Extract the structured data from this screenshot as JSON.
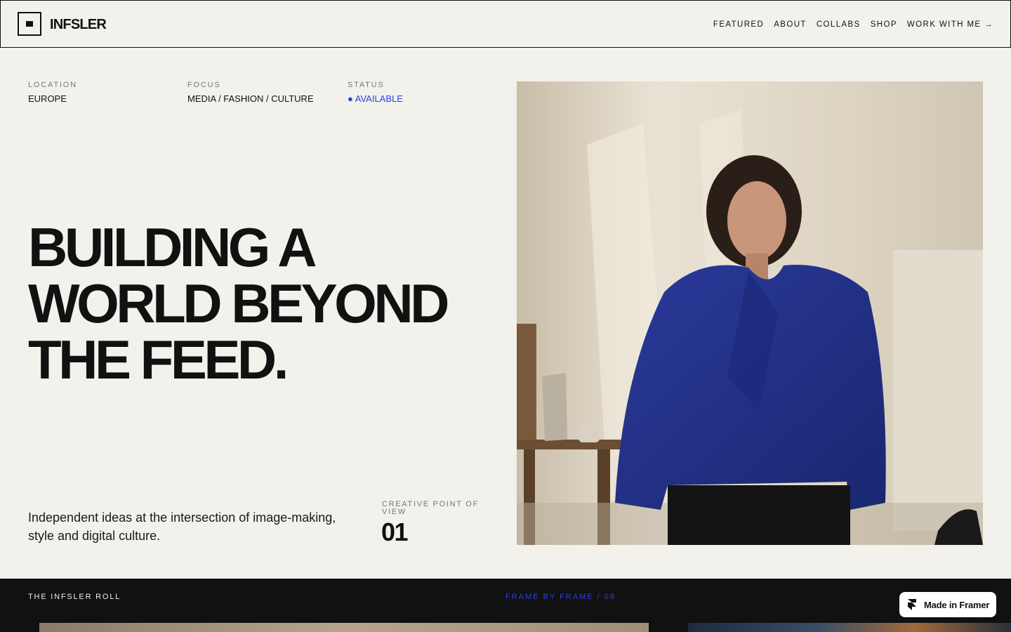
{
  "brand": {
    "name": "INFSLER",
    "logo_icon": "square-logo-icon"
  },
  "nav": {
    "links": [
      "FEATURED",
      "ABOUT",
      "COLLABS",
      "SHOP",
      "WORK WITH ME →"
    ]
  },
  "meta": [
    {
      "label": "LOCATION",
      "value": "EUROPE"
    },
    {
      "label": "FOCUS",
      "value": "MEDIA / FASHION / CULTURE"
    },
    {
      "label": "STATUS",
      "value": "● AVAILABLE"
    }
  ],
  "colors": {
    "background": "#f2f1ec",
    "ink": "#111111",
    "accent": "#2a3ee0",
    "muted": "#777777"
  },
  "hero": {
    "headline": [
      "BUILDING A",
      "WORLD BEYOND",
      "THE FEED."
    ],
    "intro": "Independent ideas at the intersection of image-making, style and digital culture.",
    "pov_label": "CREATIVE POINT OF VIEW",
    "pov_number": "01"
  },
  "band": {
    "left": "THE INFSLER ROLL",
    "center": "FRAME BY FRAME / 08"
  },
  "badge": {
    "label": "Made in Framer",
    "icon": "framer-icon"
  }
}
